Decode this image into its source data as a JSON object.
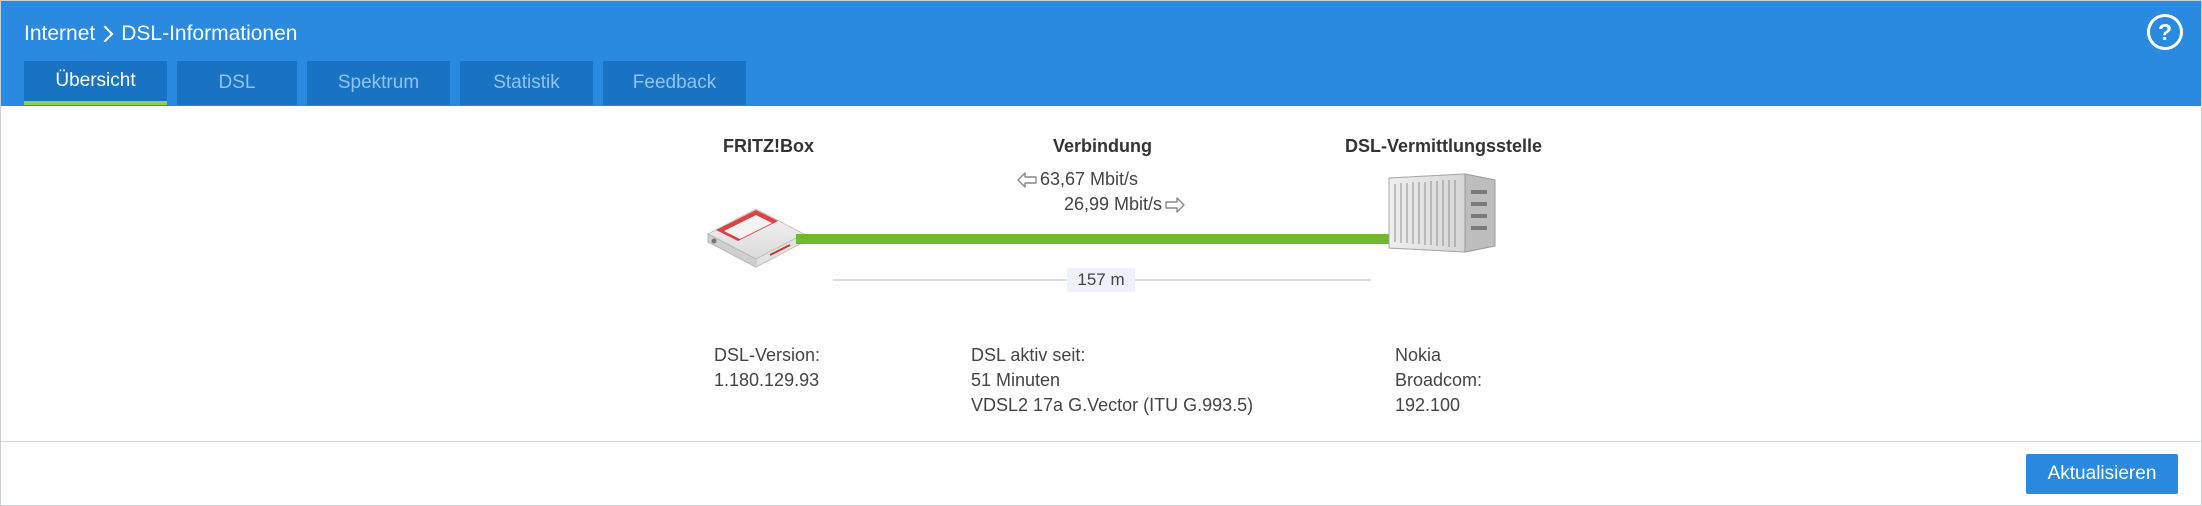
{
  "header": {
    "breadcrumb": [
      "Internet",
      "DSL-Informationen"
    ],
    "help_label": "?"
  },
  "tabs": [
    {
      "label": "Übersicht",
      "active": true
    },
    {
      "label": "DSL",
      "active": false
    },
    {
      "label": "Spektrum",
      "active": false
    },
    {
      "label": "Statistik",
      "active": false
    },
    {
      "label": "Feedback",
      "active": false
    }
  ],
  "overview": {
    "router_title": "FRITZ!Box",
    "connection_title": "Verbindung",
    "exchange_title": "DSL-Vermittlungsstelle",
    "downstream": "63,67 Mbit/s",
    "upstream": "26,99 Mbit/s",
    "distance": "157 m",
    "router_info": {
      "label": "DSL-Version:",
      "value": "1.180.129.93"
    },
    "connection_info": {
      "label": "DSL aktiv seit:",
      "duration": "51 Minuten",
      "standard": "VDSL2 17a G.Vector (ITU G.993.5)"
    },
    "exchange_info": {
      "vendor": "Nokia",
      "chipset": "Broadcom:",
      "version": "192.100"
    }
  },
  "footer": {
    "update_button": "Aktualisieren"
  },
  "colors": {
    "header_blue": "#2a8ae0",
    "tab_blue": "#1a73c2",
    "line_green": "#6fba2c",
    "active_underline": "#8fd14f"
  },
  "icons": {
    "router": "router-icon",
    "exchange": "dslam-icon",
    "downstream": "arrow-left-icon",
    "upstream": "arrow-right-icon",
    "help": "help-icon"
  }
}
